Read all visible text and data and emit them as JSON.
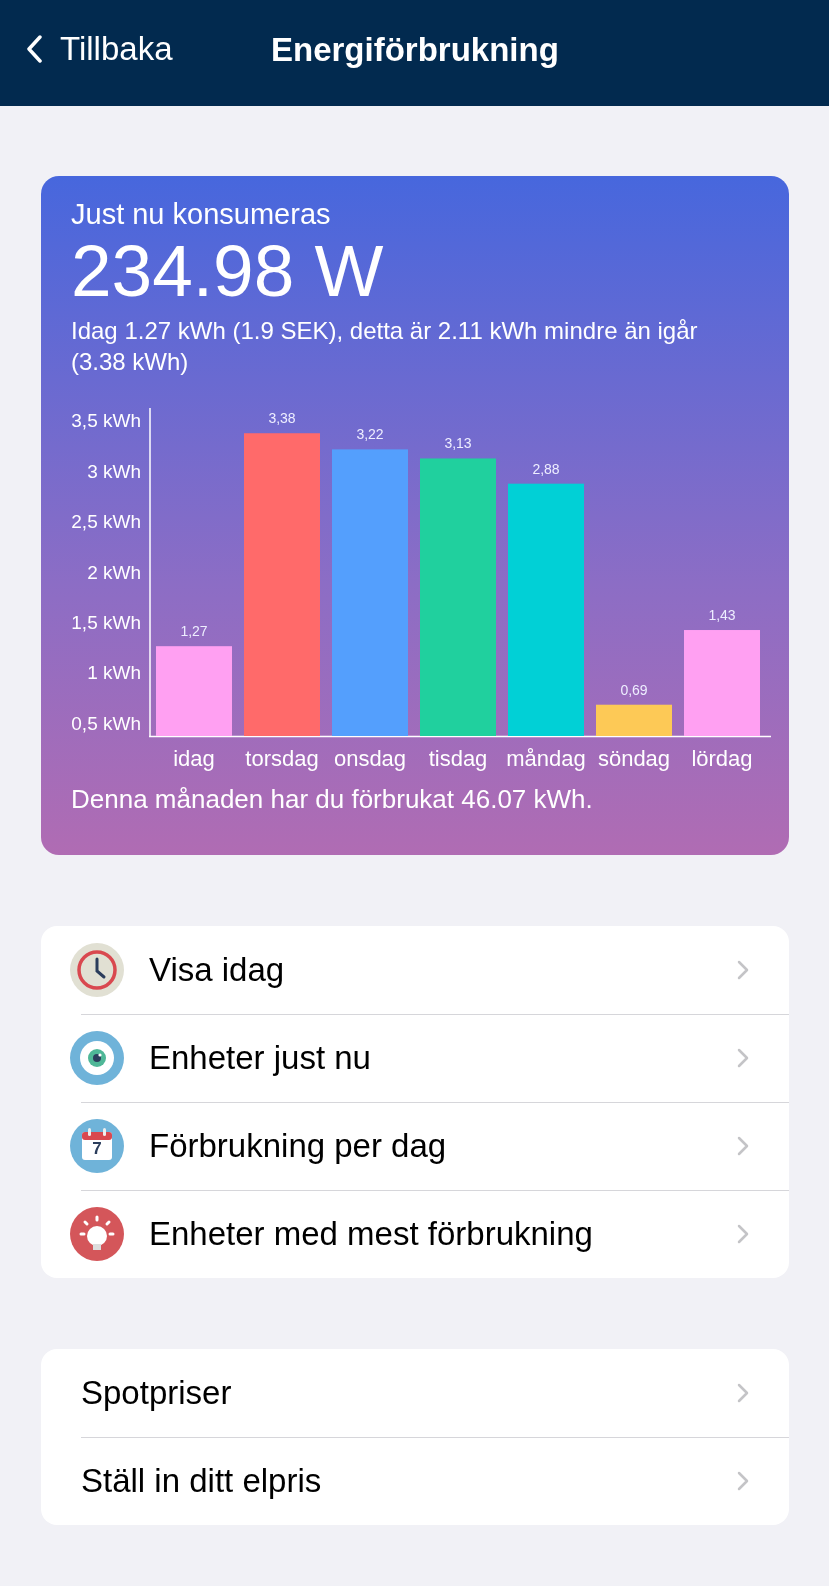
{
  "nav": {
    "back": "Tillbaka",
    "title": "Energiförbrukning"
  },
  "summary": {
    "caption": "Just nu konsumeras",
    "power": "234.98 W",
    "detail": "Idag 1.27 kWh (1.9 SEK), detta är 2.11 kWh mindre än igår (3.38 kWh)",
    "footer": "Denna månaden har du förbrukat 46.07 kWh.",
    "chart_data": {
      "type": "bar",
      "categories": [
        "idag",
        "torsdag",
        "onsdag",
        "tisdag",
        "måndag",
        "söndag",
        "lördag"
      ],
      "series": [
        {
          "color": "#ffa0f2",
          "values": [
            1.27,
            null,
            null,
            null,
            null,
            null,
            1.43
          ]
        },
        {
          "color": "#ff6a6a",
          "values": [
            null,
            3.38,
            null,
            null,
            null,
            null,
            null
          ]
        },
        {
          "color": "#549ffd",
          "values": [
            null,
            null,
            3.22,
            null,
            null,
            null,
            null
          ]
        },
        {
          "color": "#20d09e",
          "values": [
            null,
            null,
            null,
            3.13,
            null,
            null,
            null
          ]
        },
        {
          "color": "#01d0d6",
          "values": [
            null,
            null,
            null,
            null,
            2.88,
            null,
            null
          ]
        },
        {
          "color": "#fdc956",
          "values": [
            null,
            null,
            null,
            null,
            null,
            0.69,
            null
          ]
        }
      ],
      "value_labels": [
        "1,27",
        "3,38",
        "3,22",
        "3,13",
        "2,88",
        "0,69",
        "1,43"
      ],
      "ylim": [
        0.38,
        3.63
      ],
      "yticks": [
        {
          "value": 0.5,
          "label": "0,5 kWh"
        },
        {
          "value": 1,
          "label": "1 kWh"
        },
        {
          "value": 1.5,
          "label": "1,5 kWh"
        },
        {
          "value": 2,
          "label": "2 kWh"
        },
        {
          "value": 2.5,
          "label": "2,5 kWh"
        },
        {
          "value": 3,
          "label": "3 kWh"
        },
        {
          "value": 3.5,
          "label": "3,5 kWh"
        }
      ]
    }
  },
  "menu": [
    {
      "kind": "clock",
      "label": "Visa idag"
    },
    {
      "kind": "eye",
      "label": "Enheter just nu"
    },
    {
      "kind": "calendar",
      "icon_label": "7",
      "label": "Förbrukning per dag"
    },
    {
      "kind": "bulb",
      "label": "Enheter med mest förbrukning"
    }
  ],
  "settings": [
    {
      "label": "Spotpriser"
    },
    {
      "label": "Ställ in ditt elpris"
    }
  ]
}
